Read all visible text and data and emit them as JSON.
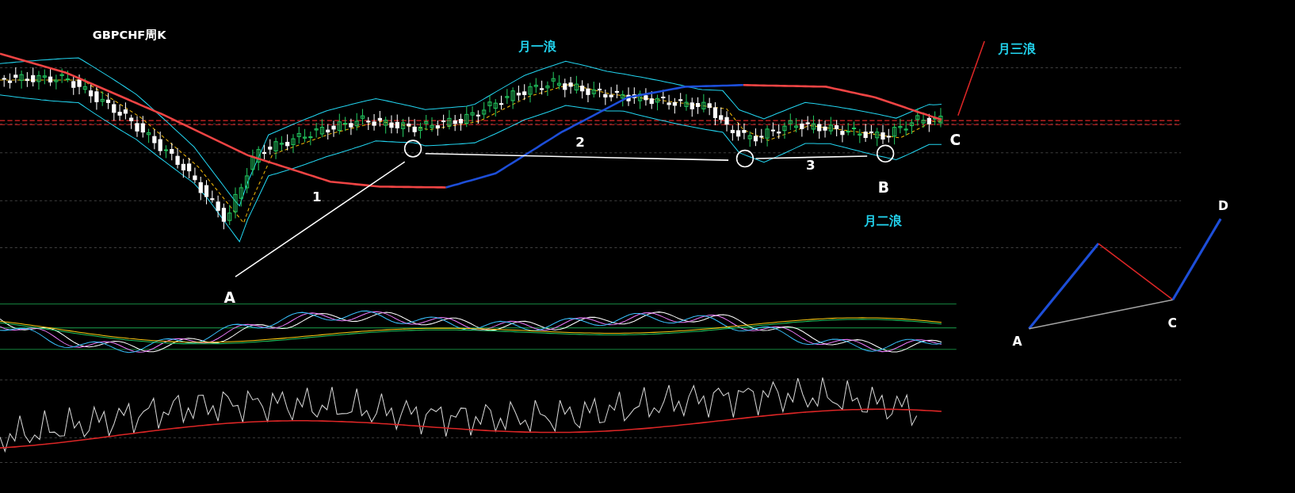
{
  "chart": {
    "title": "GBPCHF周K",
    "labels": [
      {
        "text": "月一浪"
      },
      {
        "text": "月三浪"
      },
      {
        "text": "1"
      },
      {
        "text": "2"
      },
      {
        "text": "3"
      },
      {
        "text": "A"
      },
      {
        "text": "B"
      },
      {
        "text": "C"
      },
      {
        "text": "月二浪"
      }
    ]
  },
  "diagram": {
    "labels": [
      {
        "text": "A"
      },
      {
        "text": "C"
      },
      {
        "text": "D"
      }
    ]
  }
}
